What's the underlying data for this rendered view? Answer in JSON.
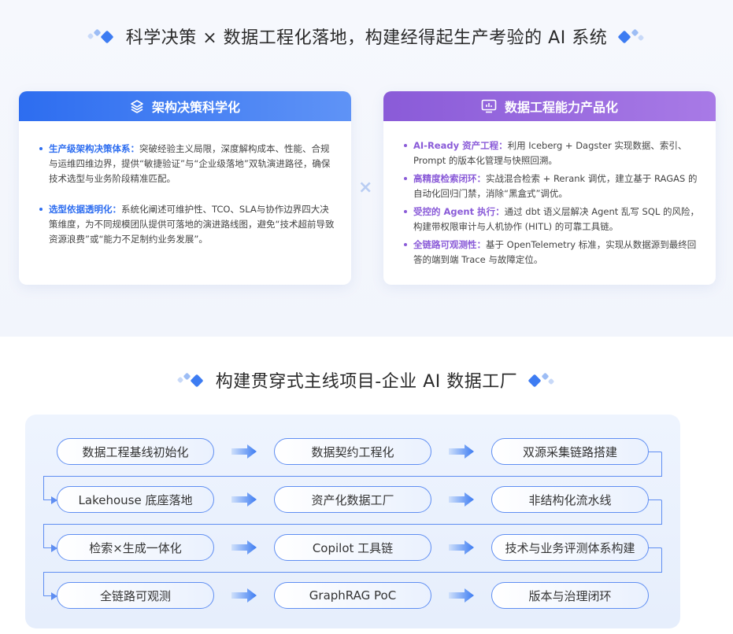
{
  "top_heading": "科学决策 × 数据工程化落地，构建经得起生产考验的 AI 系统",
  "left_card": {
    "title": "架构决策科学化",
    "icon": "layers-icon",
    "items": [
      {
        "key": "生产级架构决策体系：",
        "text": "突破经验主义局限，深度解构成本、性能、合规与运维四维边界，提供“敏捷验证”与“企业级落地”双轨演进路径，确保技术选型与业务阶段精准匹配。"
      },
      {
        "key": "选型依据透明化：",
        "text": "系统化阐述可维护性、TCO、SLA与协作边界四大决策维度，为不同规模团队提供可落地的演进路线图，避免“技术超前导致资源浪费”或“能力不足制约业务发展”。"
      }
    ]
  },
  "cross_symbol": "×",
  "right_card": {
    "title": "数据工程能力产品化",
    "icon": "monitor-chart-icon",
    "items": [
      {
        "key": "AI-Ready 资产工程：",
        "text": "利用 Iceberg + Dagster 实现数据、索引、Prompt 的版本化管理与快照回溯。"
      },
      {
        "key": "高精度检索闭环：",
        "text": "实战混合检索 + Rerank 调优，建立基于 RAGAS 的自动化回归门禁，消除“黑盒式”调优。"
      },
      {
        "key": "受控的 Agent 执行：",
        "text": "通过 dbt 语义层解决 Agent 乱写 SQL 的风险，构建带权限审计与人机协作 (HITL) 的可靠工具链。"
      },
      {
        "key": "全链路可观测性：",
        "text": "基于 OpenTelemetry 标准，实现从数据源到最终回答的端到端 Trace 与故障定位。"
      }
    ]
  },
  "bottom_heading": "构建贯穿式主线项目-企业 AI 数据工厂",
  "flow_rows": [
    [
      "数据工程基线初始化",
      "数据契约工程化",
      "双源采集链路搭建"
    ],
    [
      "Lakehouse 底座落地",
      "资产化数据工厂",
      "非结构化流水线"
    ],
    [
      "检索×生成一体化",
      "Copilot 工具链",
      "技术与业务评测体系构建"
    ],
    [
      "全链路可观测",
      "GraphRAG PoC",
      "版本与治理闭环"
    ]
  ],
  "colors": {
    "blue": "#2d6df0",
    "purple": "#8a5bd8"
  }
}
